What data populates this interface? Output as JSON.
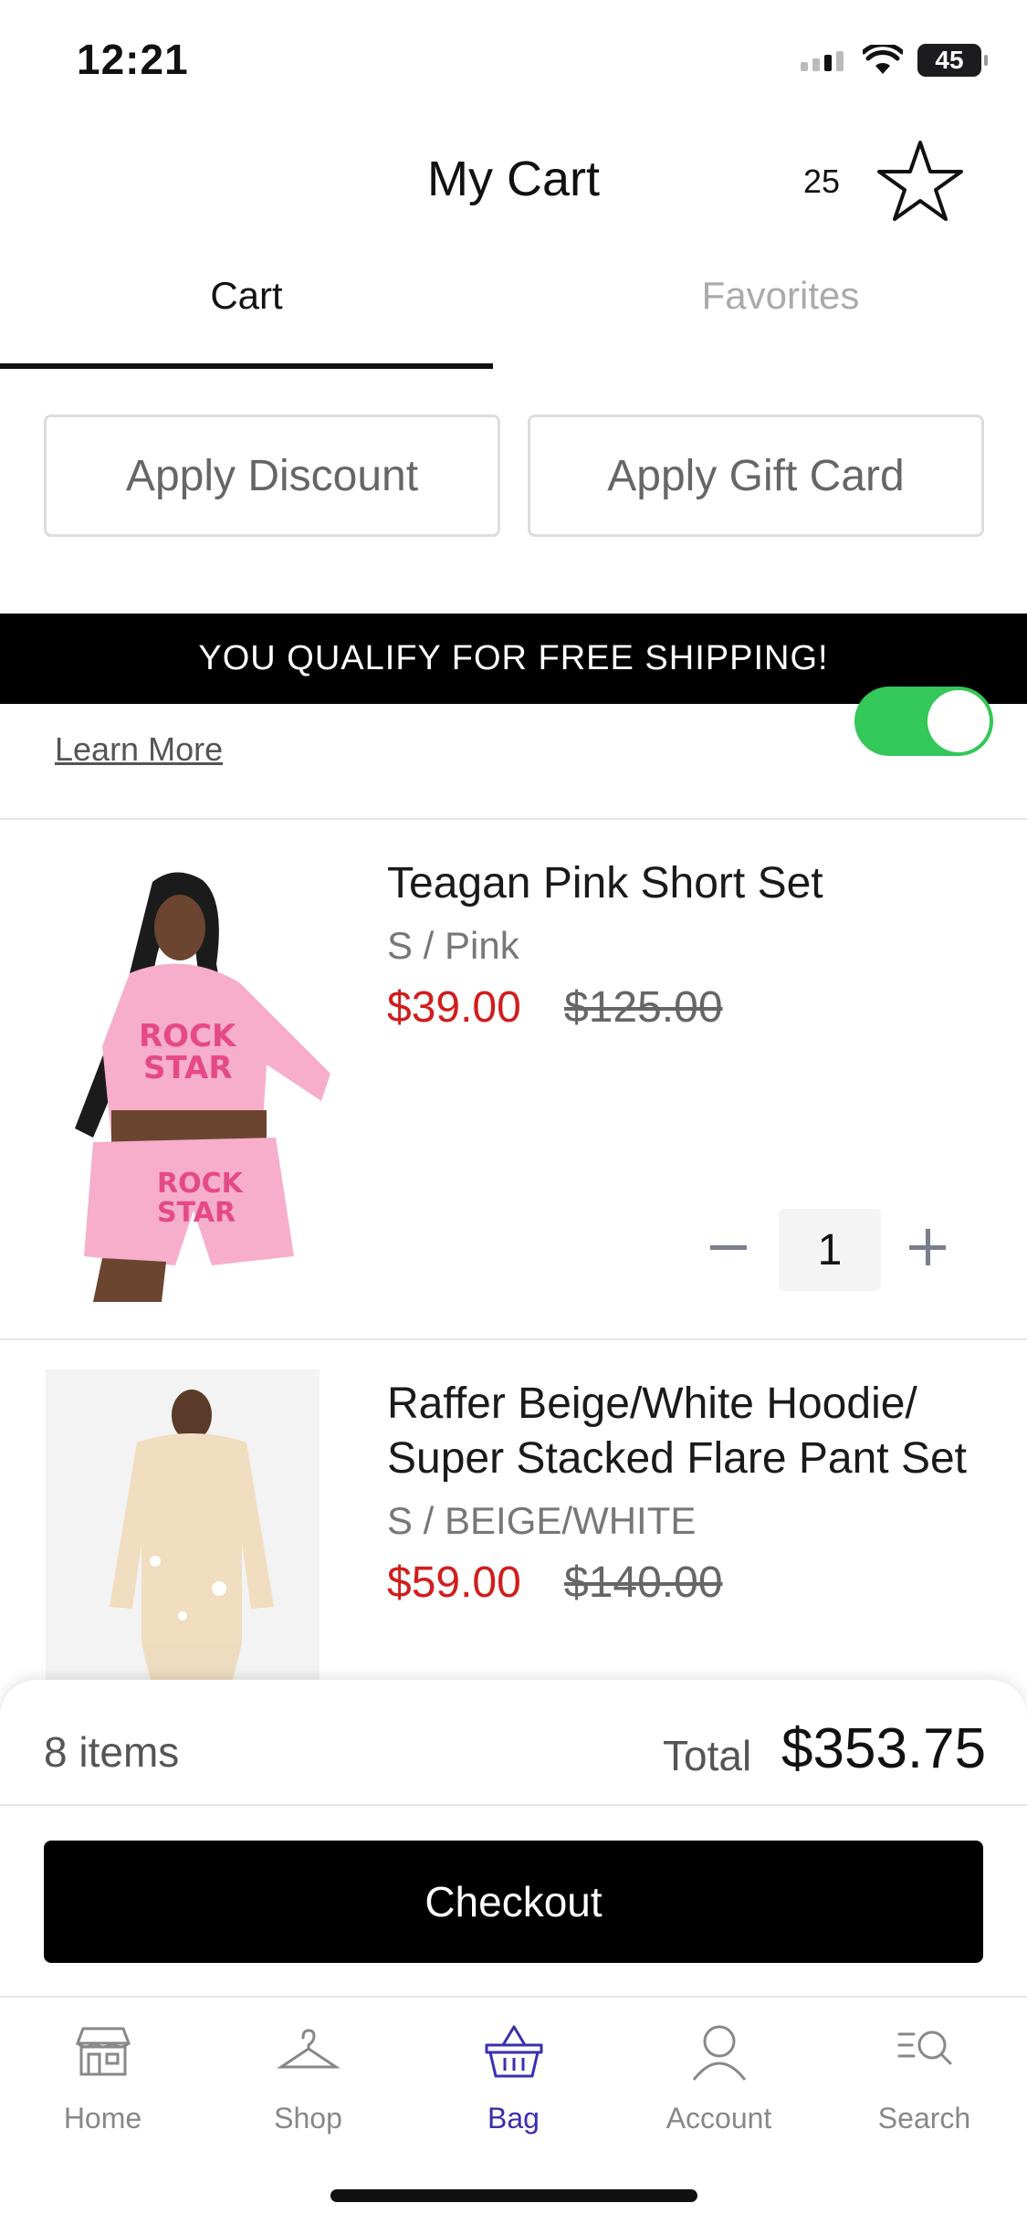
{
  "status_bar": {
    "time": "12:21",
    "battery": "45"
  },
  "header": {
    "title": "My Cart",
    "favorites_count": "25"
  },
  "tabs": [
    {
      "label": "Cart",
      "active": true
    },
    {
      "label": "Favorites",
      "active": false
    }
  ],
  "actions": {
    "discount_label": "Apply Discount",
    "gift_card_label": "Apply Gift Card"
  },
  "shipping": {
    "banner": "YOU QUALIFY FOR FREE SHIPPING!",
    "learn_more": "Learn More",
    "toggle_on": true
  },
  "cart_items": [
    {
      "name": "Teagan Pink Short Set",
      "variant": "S / Pink",
      "sale_price": "$39.00",
      "original_price": "$125.00",
      "quantity": "1"
    },
    {
      "name_line1": "Raffer Beige/White Hoodie/",
      "name_line2": "Super Stacked Flare Pant Set",
      "variant": "S / BEIGE/WHITE",
      "sale_price": "$59.00",
      "original_price": "$140.00"
    }
  ],
  "summary": {
    "items": "8 items",
    "total_label": "Total",
    "total_value": "$353.75",
    "checkout_label": "Checkout"
  },
  "nav": [
    {
      "label": "Home",
      "icon": "store-icon"
    },
    {
      "label": "Shop",
      "icon": "hanger-icon"
    },
    {
      "label": "Bag",
      "icon": "basket-icon",
      "active": true
    },
    {
      "label": "Account",
      "icon": "person-icon"
    },
    {
      "label": "Search",
      "icon": "search-list-icon"
    }
  ],
  "colors": {
    "sale": "#d11d1d",
    "toggle": "#34c759",
    "active_nav": "#3a2fb0"
  }
}
